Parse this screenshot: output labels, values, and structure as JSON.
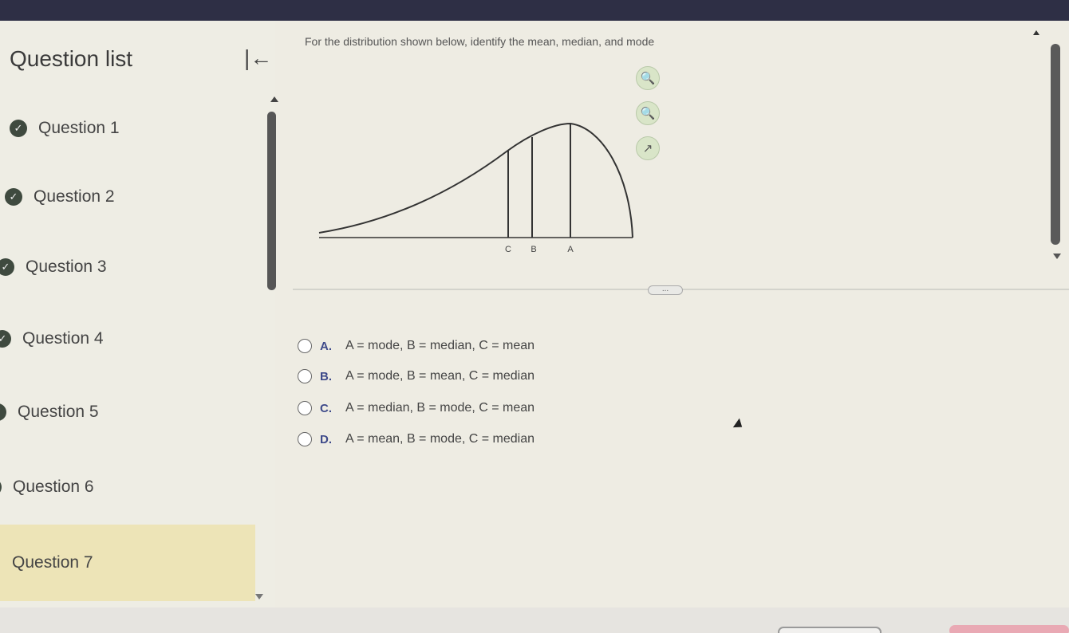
{
  "sidebar": {
    "title": "Question list",
    "collapse_icon": "collapse-left-icon",
    "items": [
      {
        "label": "Question 1",
        "completed": true
      },
      {
        "label": "Question 2",
        "completed": true
      },
      {
        "label": "Question 3",
        "completed": true
      },
      {
        "label": "Question 4",
        "completed": true
      },
      {
        "label": "Question 5",
        "completed": true
      },
      {
        "label": "Question 6",
        "completed": true
      },
      {
        "label": "Question 7",
        "completed": false,
        "active": true
      }
    ]
  },
  "question": {
    "prompt": "For the distribution shown below, identify the mean, median, and mode",
    "tools": [
      "zoom-in-icon",
      "zoom-out-icon",
      "popout-icon"
    ],
    "figure": {
      "labels": [
        "C",
        "B",
        "A"
      ]
    }
  },
  "divider_handle": "...",
  "options": [
    {
      "letter": "A.",
      "text": "A = mode, B = median, C = mean"
    },
    {
      "letter": "B.",
      "text": "A = mode, B = mean, C = median"
    },
    {
      "letter": "C.",
      "text": "A = median, B = mode, C = mean"
    },
    {
      "letter": "D.",
      "text": "A = mean, B = mode, C = median"
    }
  ],
  "colors": {
    "active_item": "#ede4b7",
    "check": "#3f4a3f",
    "topbar": "#2e2f45"
  }
}
